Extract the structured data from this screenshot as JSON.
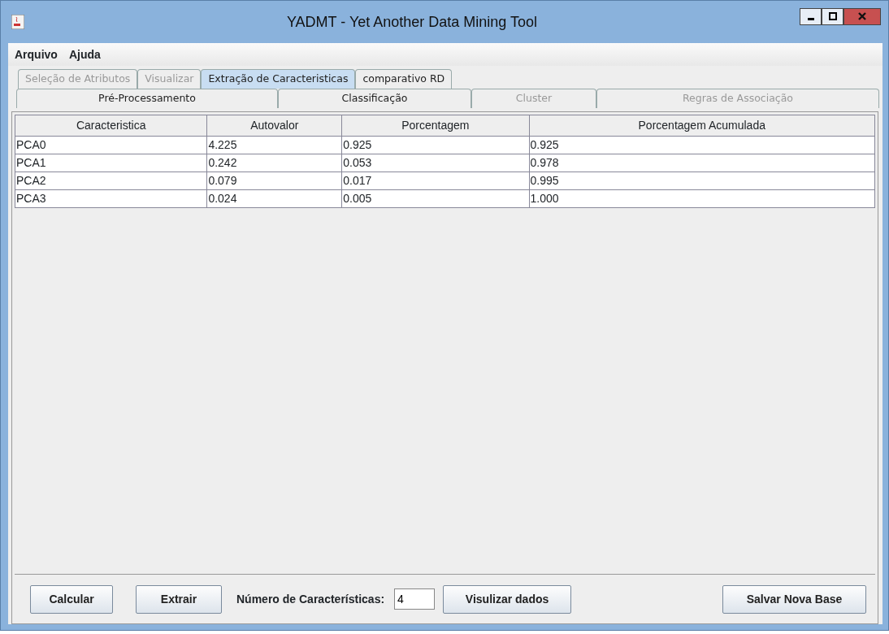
{
  "window": {
    "title": "YADMT - Yet Another Data Mining Tool"
  },
  "menu": [
    "Arquivo",
    "Ajuda"
  ],
  "tabs_row_1": [
    {
      "label": "Seleção de Atributos",
      "selected": false,
      "disabled": true
    },
    {
      "label": "Visualizar",
      "selected": false,
      "disabled": true
    },
    {
      "label": "Extração de Caracteristicas",
      "selected": true,
      "disabled": false
    },
    {
      "label": "comparativo RD",
      "selected": false,
      "disabled": false
    }
  ],
  "tabs_row_2": [
    {
      "label": "Pré-Processamento",
      "selected": false,
      "disabled": false
    },
    {
      "label": "Classificação",
      "selected": false,
      "disabled": false
    },
    {
      "label": "Cluster",
      "selected": false,
      "disabled": true
    },
    {
      "label": "Regras de Associação",
      "selected": false,
      "disabled": true
    }
  ],
  "table": {
    "columns": [
      "Caracteristica",
      "Autovalor",
      "Porcentagem",
      "Porcentagem Acumulada"
    ],
    "rows": [
      [
        "PCA0",
        "4.225",
        "0.925",
        "0.925"
      ],
      [
        "PCA1",
        "0.242",
        "0.053",
        "0.978"
      ],
      [
        "PCA2",
        "0.079",
        "0.017",
        "0.995"
      ],
      [
        "PCA3",
        "0.024",
        "0.005",
        "1.000"
      ]
    ]
  },
  "footer": {
    "calcular": "Calcular",
    "extrair": "Extrair",
    "count_label": "Número de Características:",
    "count_value": "4",
    "visualize": "Visulizar dados",
    "save": "Salvar Nova Base"
  }
}
